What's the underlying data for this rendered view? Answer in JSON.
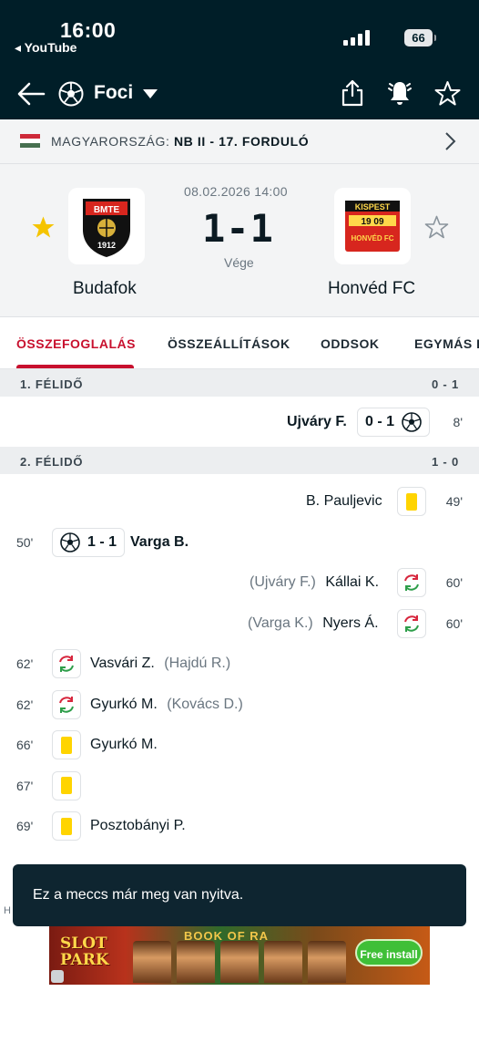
{
  "status_bar": {
    "time": "16:00",
    "back_app": "◂ YouTube",
    "battery": "66"
  },
  "nav": {
    "title": "Foci"
  },
  "league": {
    "country": "MAGYARORSZÁG:",
    "competition": "NB II - 17. FORDULÓ",
    "flag_colors": [
      "#ce2939",
      "#ffffff",
      "#477050"
    ]
  },
  "match": {
    "datetime": "08.02.2026 14:00",
    "score": "1-1",
    "status": "Vége",
    "home": {
      "name": "Budafok",
      "logo_text_top": "BMTE",
      "logo_text_bottom": "1912",
      "favorite": true
    },
    "away": {
      "name": "Honvéd FC",
      "logo_text_top": "KISPEST",
      "logo_text_year": "19 09",
      "logo_text_bottom": "HONVÉD FC",
      "favorite": false
    }
  },
  "tabs": [
    {
      "label": "ÖSSZEFOGLALÁS",
      "active": true
    },
    {
      "label": "ÖSSZEÁLLÍTÁSOK",
      "active": false
    },
    {
      "label": "ODDSOK",
      "active": false
    },
    {
      "label": "EGYMÁS E",
      "active": false
    }
  ],
  "periods": [
    {
      "label": "1. FÉLIDŐ",
      "score": "0 - 1",
      "events": [
        {
          "side": "away",
          "type": "goal",
          "minute": "8'",
          "player": "Ujváry F.",
          "score": "0 - 1"
        }
      ]
    },
    {
      "label": "2. FÉLIDŐ",
      "score": "1 - 0",
      "events": [
        {
          "side": "away",
          "type": "yellow",
          "minute": "49'",
          "player": "B. Pauljevic"
        },
        {
          "side": "home",
          "type": "goal",
          "minute": "50'",
          "player": "Varga B.",
          "score": "1 - 1"
        },
        {
          "side": "away",
          "type": "sub",
          "minute": "60'",
          "player": "Kállai K.",
          "out": "(Ujváry F.)"
        },
        {
          "side": "away",
          "type": "sub",
          "minute": "60'",
          "player": "Nyers Á.",
          "out": "(Varga K.)"
        },
        {
          "side": "home",
          "type": "sub",
          "minute": "62'",
          "player": "Vasvári Z.",
          "out": "(Hajdú R.)"
        },
        {
          "side": "home",
          "type": "sub",
          "minute": "62'",
          "player": "Gyurkó M.",
          "out": "(Kovács D.)"
        },
        {
          "side": "home",
          "type": "yellow",
          "minute": "66'",
          "player": "Gyurkó M."
        },
        {
          "side": "home",
          "type": "yellow",
          "minute": "67'",
          "player": ""
        },
        {
          "side": "home",
          "type": "yellow",
          "minute": "69'",
          "player": "Posztobányi P."
        }
      ]
    }
  ],
  "toast": "Ez a meccs már meg van nyitva.",
  "ad": {
    "title_line1": "SLOT",
    "title_line2": "PARK",
    "game": "BOOK OF RA",
    "cta": "Free install",
    "cut_text": "H"
  },
  "colors": {
    "header_bg": "#001e28",
    "accent": "#c8102e",
    "yellow_card": "#ffd400",
    "star_active": "#f5c400",
    "sub_in": "#2e9e4a",
    "sub_out": "#d7263d"
  }
}
